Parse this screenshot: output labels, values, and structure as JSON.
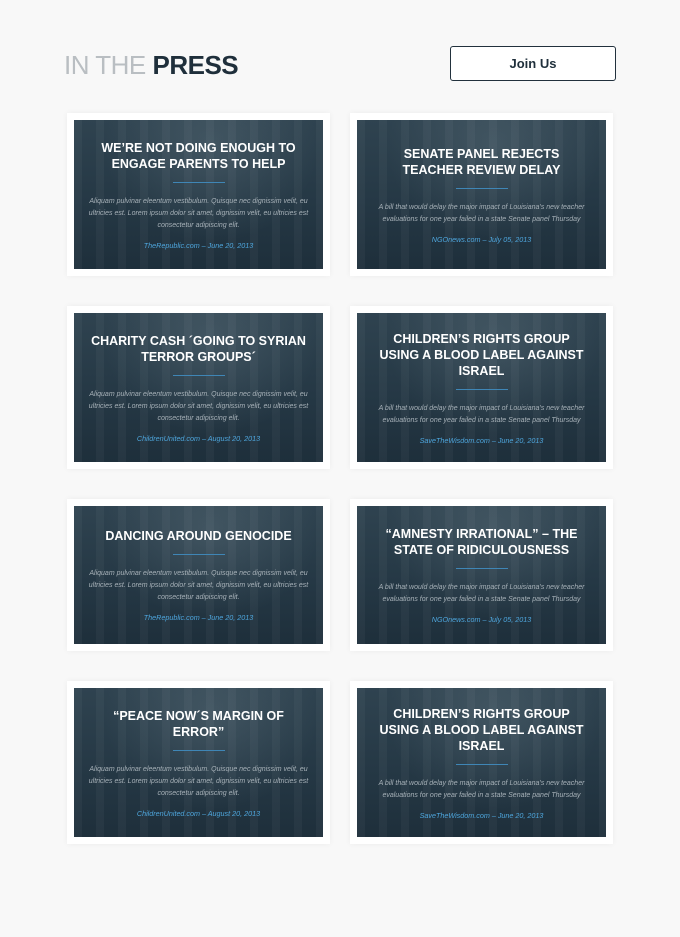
{
  "header": {
    "title_light": "IN THE",
    "title_bold": "PRESS",
    "join_label": "Join Us"
  },
  "cards": [
    {
      "title": "WE’RE NOT DOING ENOUGH TO ENGAGE PARENTS TO HELP",
      "description": "Aliquam pulvinar eleentum vestibulum. Quisque nec dignissim velit, eu ultricies est. Lorem ipsum dolor sit amet, dignissim velit, eu ultricies est consectetur adipiscing elit.",
      "source": "TheRepublic.com – June 20, 2013"
    },
    {
      "title": "SENATE PANEL REJECTS TEACHER REVIEW DELAY",
      "description": "A bill that would delay the major impact of Louisiana’s new teacher evaluations for one year failed in a state Senate panel Thursday",
      "source": "NGOnews.com – July 05, 2013"
    },
    {
      "title": "CHARITY CASH ´GOING TO SYRIAN TERROR GROUPS´",
      "description": "Aliquam pulvinar eleentum vestibulum. Quisque nec dignissim velit, eu ultricies est. Lorem ipsum dolor sit amet, dignissim velit, eu ultricies est consectetur adipiscing elit.",
      "source": "ChildrenUnited.com – August 20, 2013"
    },
    {
      "title": "CHILDREN’S RIGHTS GROUP USING A BLOOD LABEL AGAINST ISRAEL",
      "description": "A bill that would delay the major impact of Louisiana’s new teacher evaluations for one year failed in a state Senate panel Thursday",
      "source": "SaveTheWisdom.com – June 20, 2013"
    },
    {
      "title": "DANCING AROUND GENOCIDE",
      "description": "Aliquam pulvinar eleentum vestibulum. Quisque nec dignissim velit, eu ultricies est. Lorem ipsum dolor sit amet, dignissim velit, eu ultricies est consectetur adipiscing elit.",
      "source": "TheRepublic.com – June 20, 2013"
    },
    {
      "title": "“AMNESTY IRRATIONAL” – THE STATE OF RIDICULOUSNESS",
      "description": "A bill that would delay the major impact of Louisiana’s new teacher evaluations for one year failed in a state Senate panel Thursday",
      "source": "NGOnews.com – July 05, 2013"
    },
    {
      "title": "“PEACE NOW´S MARGIN OF ERROR”",
      "description": "Aliquam pulvinar eleentum vestibulum. Quisque nec dignissim velit, eu ultricies est. Lorem ipsum dolor sit amet, dignissim velit, eu ultricies est consectetur adipiscing elit.",
      "source": "ChildrenUnited.com – August 20, 2013"
    },
    {
      "title": "CHILDREN’S RIGHTS GROUP USING A BLOOD LABEL AGAINST ISRAEL",
      "description": "A bill that would delay the major impact of Louisiana’s new teacher evaluations for one year failed in a state Senate panel Thursday",
      "source": "SaveTheWisdom.com – June 20, 2013"
    }
  ]
}
